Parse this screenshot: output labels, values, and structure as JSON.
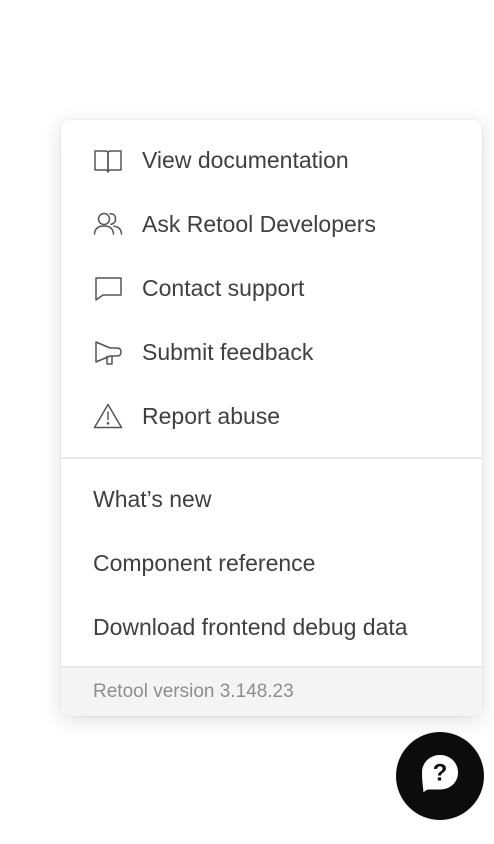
{
  "menu": {
    "primary_items": [
      {
        "label": "View documentation",
        "icon": "book-icon"
      },
      {
        "label": "Ask Retool Developers",
        "icon": "users-icon"
      },
      {
        "label": "Contact support",
        "icon": "message-icon"
      },
      {
        "label": "Submit feedback",
        "icon": "megaphone-icon"
      },
      {
        "label": "Report abuse",
        "icon": "warning-icon"
      }
    ],
    "secondary_items": [
      {
        "label": "What’s new"
      },
      {
        "label": "Component reference"
      },
      {
        "label": "Download frontend debug data"
      }
    ],
    "footer": "Retool version 3.148.23"
  },
  "help_button": {
    "icon": "help-chat-icon"
  },
  "colors": {
    "text": "#3f3f3f",
    "muted": "#8e8e8e",
    "fab": "#0c0c0c"
  }
}
